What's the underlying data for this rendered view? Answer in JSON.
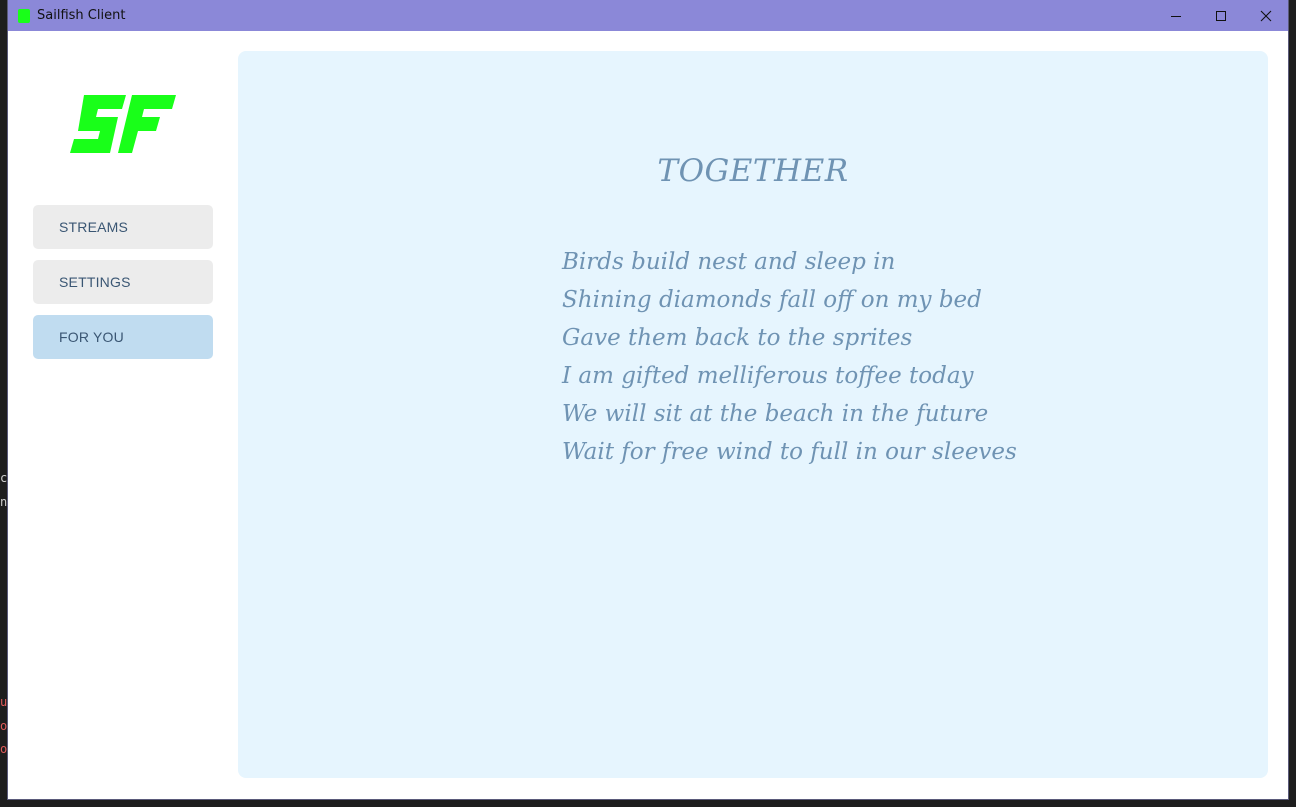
{
  "window": {
    "title": "Sailfish Client",
    "accent_color": "#8b88d8",
    "app_icon": "app-icon",
    "controls": {
      "minimize_icon": "minimize-icon",
      "maximize_icon": "maximize-icon",
      "close_icon": "close-icon"
    }
  },
  "sidebar": {
    "logo": {
      "text": "SF",
      "color": "#19ff19"
    },
    "items": [
      {
        "label": "STREAMS",
        "active": false
      },
      {
        "label": "SETTINGS",
        "active": false
      },
      {
        "label": "FOR YOU",
        "active": true
      }
    ],
    "active_color": "#c0dcf0"
  },
  "content": {
    "background": "#e6f5fe",
    "title": "TOGETHER",
    "lines": [
      "Birds build nest and sleep in",
      "Shining diamonds fall off on my bed",
      "Gave them back to the sprites",
      "I am gifted melliferous toffee today",
      "We will sit at the beach in the future",
      "Wait for free wind to full in our sleeves"
    ],
    "text_color": "#6f93b3"
  }
}
